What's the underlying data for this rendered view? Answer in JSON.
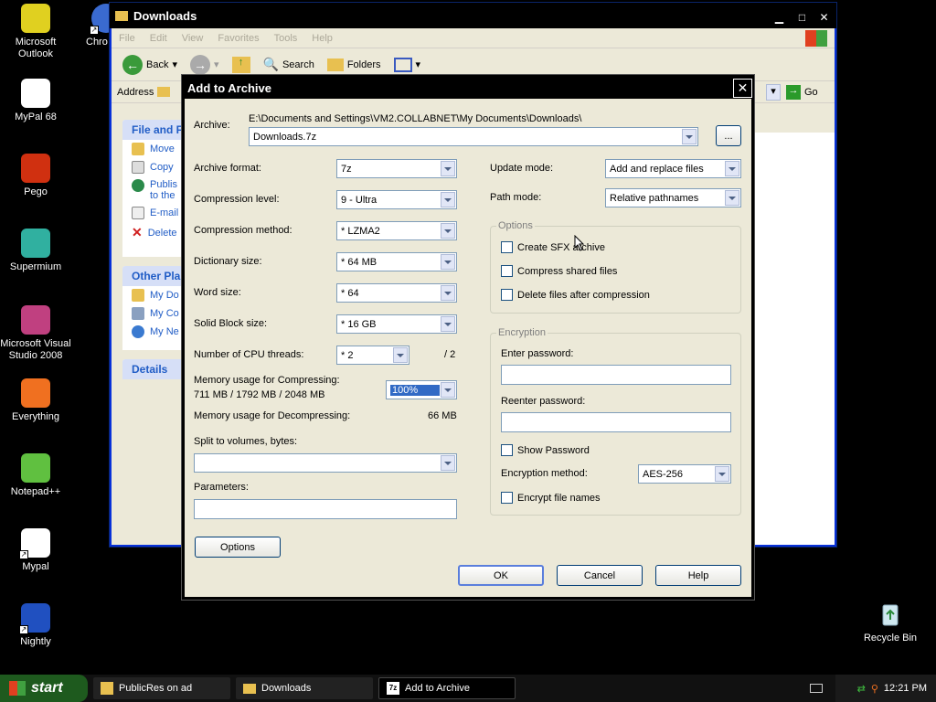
{
  "desktop_icons": [
    {
      "label": "Microsoft Outlook",
      "icon": "outlook-icon",
      "color": "#e0d020"
    },
    {
      "label": "MyPal 68",
      "icon": "mypal-icon",
      "color": "#ffffff"
    },
    {
      "label": "Pego",
      "icon": "pego-icon",
      "color": "#d03010"
    },
    {
      "label": "Supermium",
      "icon": "supermium-icon",
      "color": "#30b0a0"
    },
    {
      "label": "Microsoft Visual Studio 2008",
      "icon": "visual-studio-icon",
      "color": "#c04080"
    },
    {
      "label": "Everything",
      "icon": "everything-icon",
      "color": "#f07020"
    },
    {
      "label": "Notepad++",
      "icon": "notepadpp-icon",
      "color": "#60c040"
    },
    {
      "label": "Mypal",
      "icon": "mypal2-icon",
      "color": "#ffffff"
    },
    {
      "label": "Nightly",
      "icon": "nightly-icon",
      "color": "#2050c0"
    }
  ],
  "desktop_partial_icon": {
    "label": "Chro"
  },
  "recycle_bin": {
    "label": "Recycle Bin"
  },
  "explorer": {
    "title": "Downloads",
    "menu": [
      "File",
      "Edit",
      "View",
      "Favorites",
      "Tools",
      "Help"
    ],
    "toolbar": {
      "back": "Back",
      "search": "Search",
      "folders": "Folders"
    },
    "address_label": "Address",
    "go_label": "Go",
    "tasks": {
      "file_header": "File and F",
      "file_items": [
        "Move",
        "Copy",
        "Publis",
        "E-mail",
        "Delete"
      ],
      "publish_line2": "to the",
      "other_header": "Other Pla",
      "other_items": [
        "My Do",
        "My Co",
        "My Ne"
      ],
      "details_header": "Details"
    }
  },
  "dialog": {
    "title": "Add to Archive",
    "archive_label": "Archive:",
    "archive_path": "E:\\Documents and Settings\\VM2.COLLABNET\\My Documents\\Downloads\\",
    "archive_name": "Downloads.7z",
    "browse_label": "...",
    "fields": {
      "archive_format": {
        "label": "Archive format:",
        "value": "7z"
      },
      "compression_level": {
        "label": "Compression level:",
        "value": "9 - Ultra"
      },
      "compression_method": {
        "label": "Compression method:",
        "value": "* LZMA2"
      },
      "dictionary_size": {
        "label": "Dictionary size:",
        "value": "* 64 MB"
      },
      "word_size": {
        "label": "Word size:",
        "value": "* 64"
      },
      "solid_block_size": {
        "label": "Solid Block size:",
        "value": "* 16 GB"
      },
      "cpu_threads": {
        "label": "Number of CPU threads:",
        "value": "* 2",
        "max": "/ 2"
      }
    },
    "memory_compress_label": "Memory usage for Compressing:",
    "memory_compress_value": "711 MB / 1792 MB / 2048 MB",
    "memory_percent": "100%",
    "memory_decompress_label": "Memory usage for Decompressing:",
    "memory_decompress_value": "66 MB",
    "split_label": "Split to volumes, bytes:",
    "parameters_label": "Parameters:",
    "options_button": "Options",
    "update_mode": {
      "label": "Update mode:",
      "value": "Add and replace files"
    },
    "path_mode": {
      "label": "Path mode:",
      "value": "Relative pathnames"
    },
    "options_group": {
      "title": "Options",
      "create_sfx": "Create SFX archive",
      "compress_shared": "Compress shared files",
      "delete_after": "Delete files after compression"
    },
    "encryption_group": {
      "title": "Encryption",
      "enter_password": "Enter password:",
      "reenter_password": "Reenter password:",
      "show_password": "Show Password",
      "method_label": "Encryption method:",
      "method_value": "AES-256",
      "encrypt_names": "Encrypt file names"
    },
    "buttons": {
      "ok": "OK",
      "cancel": "Cancel",
      "help": "Help"
    }
  },
  "taskbar": {
    "start": "start",
    "tasks": [
      "PublicRes on ad",
      "Downloads",
      "Add to Archive"
    ],
    "time": "12:21 PM"
  }
}
